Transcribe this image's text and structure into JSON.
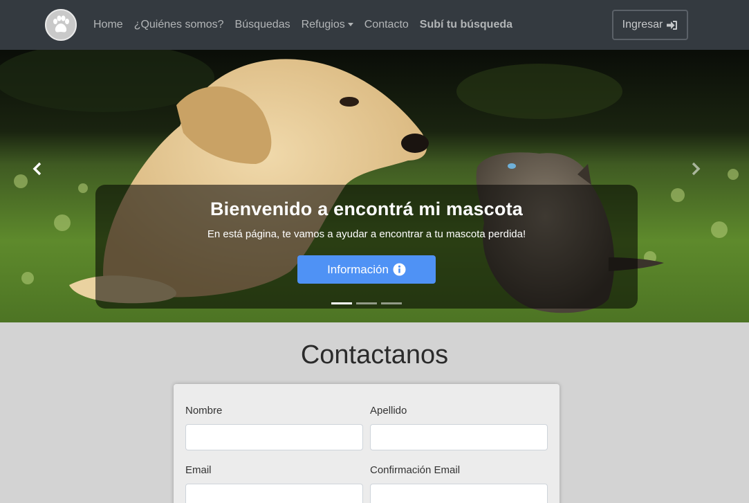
{
  "nav": {
    "links": [
      "Home",
      "¿Quiénes somos?",
      "Búsquedas",
      "Refugios",
      "Contacto",
      "Subí tu búsqueda"
    ],
    "login_label": "Ingresar"
  },
  "hero": {
    "title": "Bienvenido a encontrá mi mascota",
    "subtitle": "En está página, te vamos a ayudar a encontrar a tu mascota perdida!",
    "button_label": "Información",
    "active_slide": 1,
    "slide_count": 3
  },
  "contact": {
    "title": "Contactanos",
    "fields": {
      "nombre_label": "Nombre",
      "apellido_label": "Apellido",
      "email_label": "Email",
      "email_confirm_label": "Confirmación Email"
    }
  },
  "colors": {
    "navbar": "#343a40",
    "primary_button": "#4f92f5",
    "page_bg": "#d3d3d3"
  },
  "icons": [
    "paw-icon",
    "sign-in-icon",
    "info-circle-icon",
    "chevron-left-icon",
    "chevron-right-icon"
  ]
}
